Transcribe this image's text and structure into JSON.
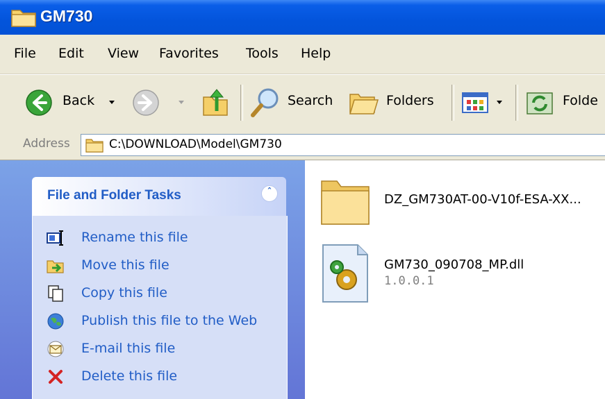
{
  "window": {
    "title": "GM730"
  },
  "menu": [
    "File",
    "Edit",
    "View",
    "Favorites",
    "Tools",
    "Help"
  ],
  "toolbar": {
    "back_label": "Back",
    "search_label": "Search",
    "folders_label": "Folders",
    "folder_sync_label": "Folde"
  },
  "address": {
    "label": "Address",
    "value": "C:\\DOWNLOAD\\Model\\GM730"
  },
  "tasks": {
    "title": "File and Folder Tasks",
    "items": [
      {
        "label": "Rename this file",
        "icon": "rename-icon"
      },
      {
        "label": "Move this file",
        "icon": "move-icon"
      },
      {
        "label": "Copy this file",
        "icon": "copy-icon"
      },
      {
        "label": "Publish this file to the Web",
        "icon": "publish-web-icon"
      },
      {
        "label": "E-mail this file",
        "icon": "email-icon"
      },
      {
        "label": "Delete this file",
        "icon": "delete-icon"
      }
    ]
  },
  "files": [
    {
      "name": "DZ_GM730AT-00-V10f-ESA-XX...",
      "icon": "folder-icon"
    },
    {
      "name": "GM730_090708_MP.dll",
      "version": "1.0.0.1",
      "icon": "dll-file-icon"
    }
  ],
  "colors": {
    "titlebar": "#0354db",
    "chrome": "#ece9d8",
    "task_pane_bg": "#6f8fdd",
    "task_link": "#215dc6"
  }
}
